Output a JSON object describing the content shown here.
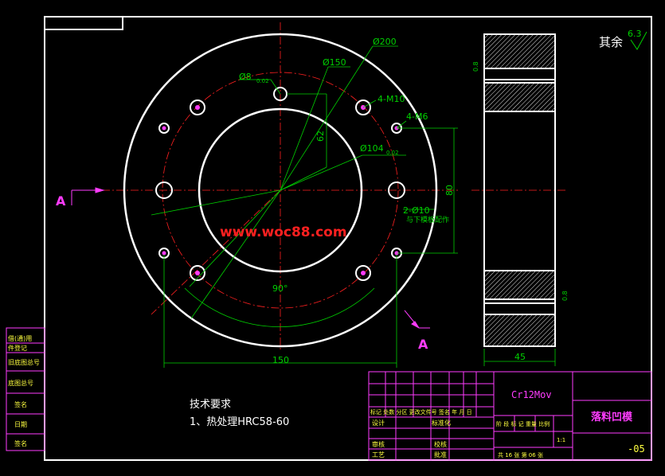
{
  "drawing": {
    "surface_finish": {
      "prefix": "其余",
      "value": "6.3"
    },
    "section_marker": "A",
    "dims": {
      "d200": "Ø200",
      "d150": "Ø150",
      "d8": "Ø8",
      "d8_tol": "0.02",
      "d104": "Ø104",
      "d104_tol": "0.02",
      "m10": "4-M10",
      "m6": "4-M6",
      "d62": "62",
      "d80": "80",
      "d10": "2-Ø10",
      "d10_note": "与下模板配作",
      "angle": "90°",
      "width150": "150",
      "width45": "45",
      "gap08_top": "0.8",
      "gap08_bot": "0.8"
    },
    "watermark": "www.woc88.com"
  },
  "notes": {
    "title": "技术要求",
    "item1": "1、热处理HRC58-60"
  },
  "left_strip": [
    "借(通)用",
    "件登记",
    "旧底图总号",
    "底图总号",
    "签名",
    "日期",
    "签名",
    "日期"
  ],
  "title_block": {
    "material": "Cr12Mov",
    "part_name": "落料凹模",
    "drawing_no": "-05",
    "rev_header": "标记 处数 分区 更改文件号 签名 年 月 日",
    "row_design": "设计",
    "row_std": "标准化",
    "row_check": "审核",
    "row_craft": "工艺",
    "row_verify": "校核",
    "row_approve": "批准",
    "stage_header": "阶 段 标 记   重量  比例",
    "scale": "1:1",
    "sheets": "共 16 张  第 06 张"
  },
  "colors": {
    "frame": "#ffffff",
    "dimension": "#00d000",
    "centerline": "#ff2020",
    "text": "#ffff40",
    "table": "#ff3cff",
    "watermark": "#ff2020"
  }
}
